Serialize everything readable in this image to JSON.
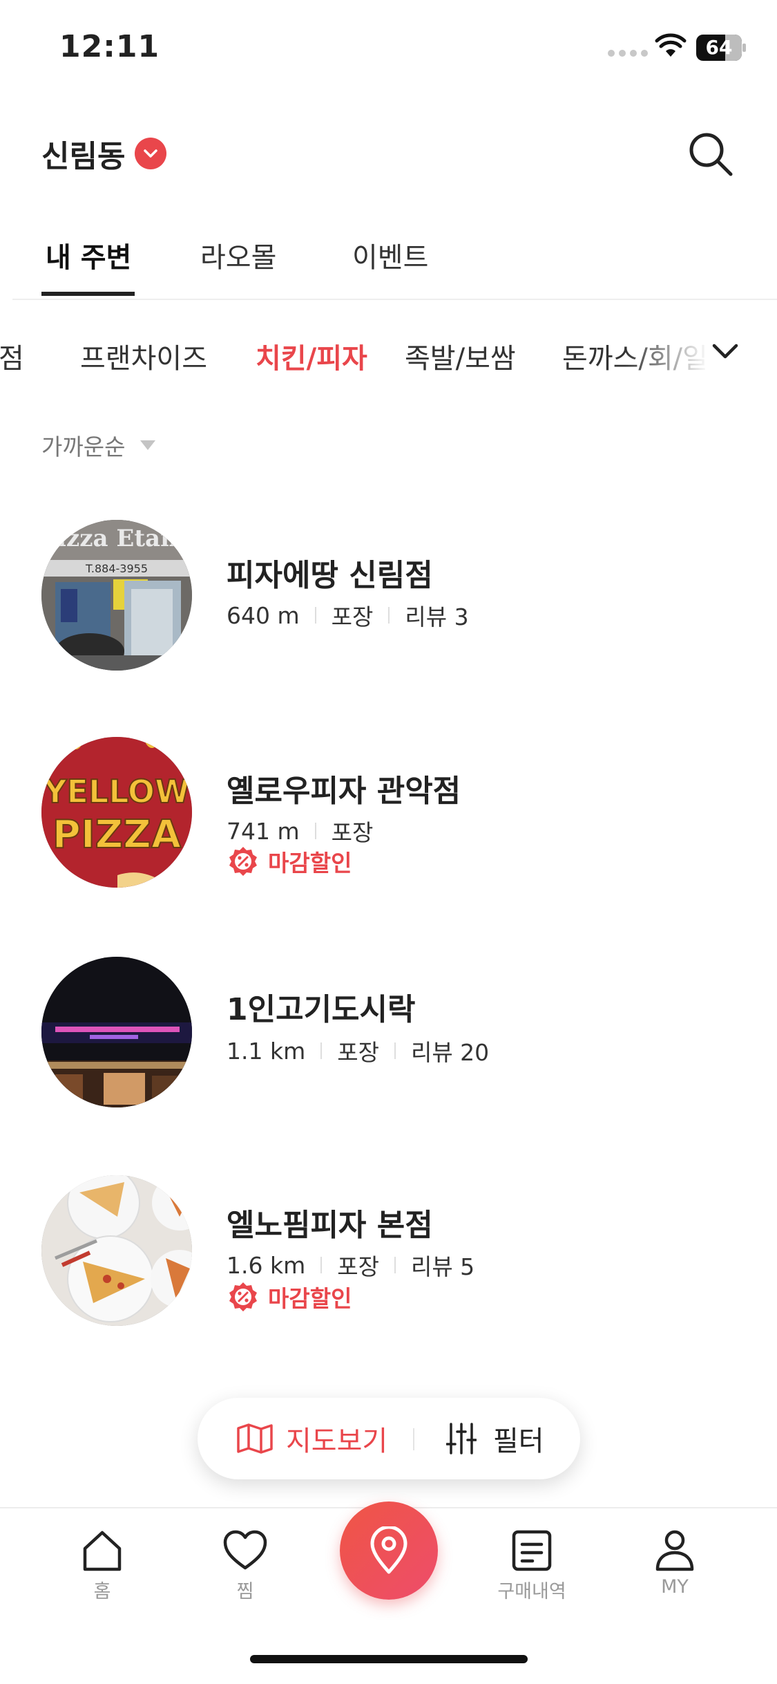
{
  "status_bar": {
    "time": "12:11",
    "battery": "64"
  },
  "header": {
    "location": "신림동"
  },
  "top_tabs": [
    {
      "label": "내 주변",
      "active": true
    },
    {
      "label": "라오몰",
      "active": false
    },
    {
      "label": "이벤트",
      "active": false
    }
  ],
  "categories": [
    {
      "label": "점",
      "active": false
    },
    {
      "label": "프랜차이즈",
      "active": false
    },
    {
      "label": "치킨/피자",
      "active": true
    },
    {
      "label": "족발/보쌈",
      "active": false
    },
    {
      "label": "돈까스/회/일식",
      "active": false
    }
  ],
  "sort": {
    "label": "가까운순"
  },
  "stores": [
    {
      "name": "피자에땅 신림점",
      "distance": "640 m",
      "type": "포장",
      "review": "리뷰 3",
      "discount": ""
    },
    {
      "name": "옐로우피자 관악점",
      "distance": "741 m",
      "type": "포장",
      "review": "",
      "discount": "마감할인"
    },
    {
      "name": "1인고기도시락",
      "distance": "1.1 km",
      "type": "포장",
      "review": "리뷰 20",
      "discount": ""
    },
    {
      "name": "엘노핌피자 본점",
      "distance": "1.6 km",
      "type": "포장",
      "review": "리뷰 5",
      "discount": "마감할인"
    }
  ],
  "thumbnails": {
    "store1_sign_text": "Pizza Etang",
    "store1_phone": "T.884-3955",
    "store2_logo_line1": "YELLOW",
    "store2_logo_line2": "PIZZA"
  },
  "floating_actions": {
    "map_label": "지도보기",
    "filter_label": "필터"
  },
  "bottom_nav": {
    "home": "홈",
    "wishlist": "찜",
    "orders": "구매내역",
    "my": "MY"
  },
  "colors": {
    "accent": "#e9464b",
    "text": "#222222",
    "muted": "#9a9a9a"
  }
}
